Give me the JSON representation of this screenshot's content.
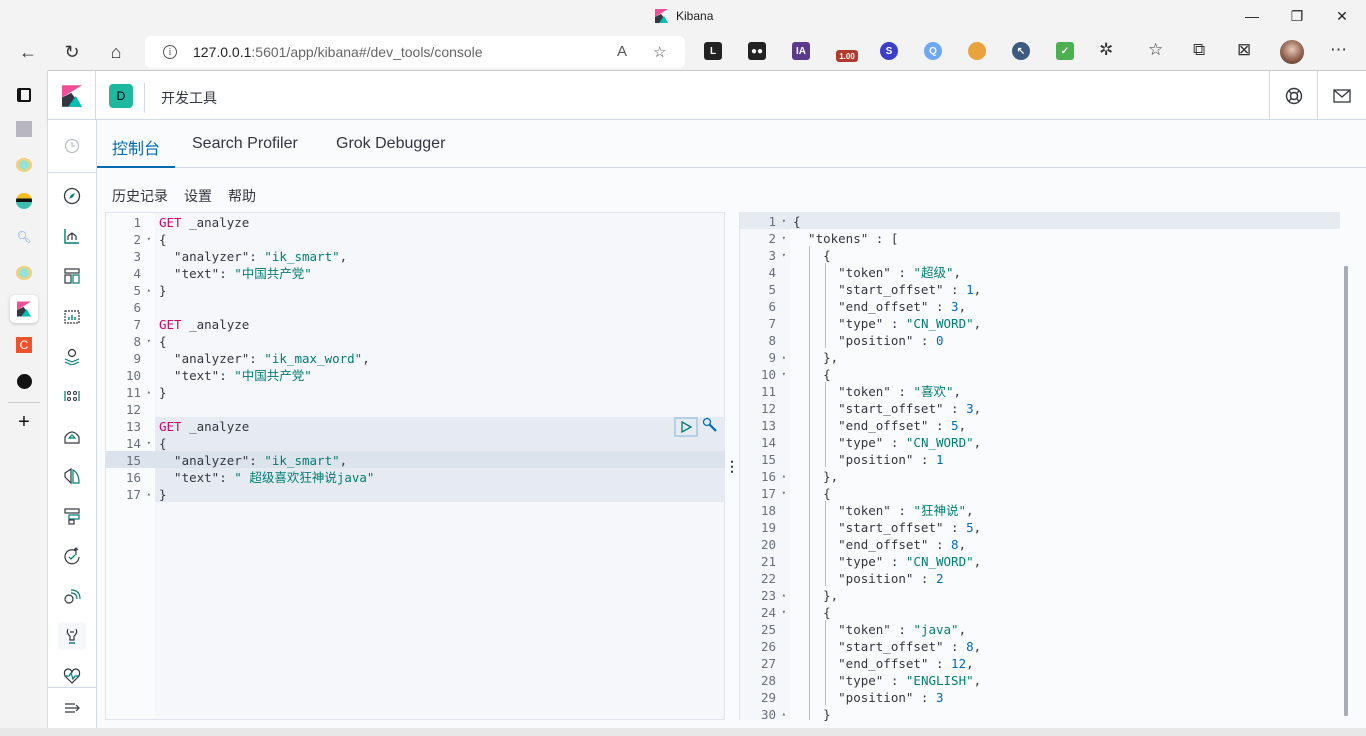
{
  "browser": {
    "tab_title": "Kibana",
    "url_host": "127.0.0.1",
    "url_rest": ":5601/app/kibana#/dev_tools/console",
    "extensions": [
      {
        "name": "leetcode-ext",
        "label": "L",
        "color": "#222222"
      },
      {
        "name": "tampermonkey-ext",
        "label": "●●",
        "color": "#222222"
      },
      {
        "name": "ia-ext",
        "label": "IA",
        "color": "#5b3a8c"
      },
      {
        "name": "video-speed-ext",
        "label": "1.00",
        "color": "#b03a2e"
      },
      {
        "name": "s-ext",
        "label": "S",
        "color": "#3b3fc7"
      },
      {
        "name": "search-ext",
        "label": "Q",
        "color": "#6fa8f7"
      },
      {
        "name": "fruit-ext",
        "label": "",
        "color": "#e8a33c"
      },
      {
        "name": "cursor-ext",
        "label": "↖",
        "color": "#3d5a80"
      },
      {
        "name": "adguard-ext",
        "label": "✓",
        "color": "#4caf50"
      }
    ]
  },
  "kibana": {
    "space_initial": "D",
    "breadcrumb": "开发工具",
    "tabs": [
      "控制台",
      "Search Profiler",
      "Grok Debugger"
    ],
    "active_tab": 0,
    "menu": [
      "历史记录",
      "设置",
      "帮助"
    ]
  },
  "colors": {
    "accent": "#006bb4",
    "space": "#1eb7a0",
    "keyword": "#c80a68",
    "string": "#017d73"
  },
  "editor": {
    "lines": [
      {
        "n": "1",
        "fold": "",
        "parts": [
          [
            "kw",
            "GET"
          ],
          [
            "key",
            " _analyze"
          ]
        ]
      },
      {
        "n": "2",
        "fold": "▾",
        "parts": [
          [
            "key",
            "{"
          ]
        ]
      },
      {
        "n": "3",
        "fold": "",
        "parts": [
          [
            "key",
            "  \"analyzer\": "
          ],
          [
            "str",
            "\"ik_smart\""
          ],
          [
            "key",
            ","
          ]
        ]
      },
      {
        "n": "4",
        "fold": "",
        "parts": [
          [
            "key",
            "  \"text\": "
          ],
          [
            "str",
            "\"中国共产党\""
          ]
        ]
      },
      {
        "n": "5",
        "fold": "▴",
        "parts": [
          [
            "key",
            "}"
          ]
        ]
      },
      {
        "n": "6",
        "fold": "",
        "parts": []
      },
      {
        "n": "7",
        "fold": "",
        "parts": [
          [
            "kw",
            "GET"
          ],
          [
            "key",
            " _analyze"
          ]
        ]
      },
      {
        "n": "8",
        "fold": "▾",
        "parts": [
          [
            "key",
            "{"
          ]
        ]
      },
      {
        "n": "9",
        "fold": "",
        "parts": [
          [
            "key",
            "  \"analyzer\": "
          ],
          [
            "str",
            "\"ik_max_word\""
          ],
          [
            "key",
            ","
          ]
        ]
      },
      {
        "n": "10",
        "fold": "",
        "parts": [
          [
            "key",
            "  \"text\": "
          ],
          [
            "str",
            "\"中国共产党\""
          ]
        ]
      },
      {
        "n": "11",
        "fold": "▴",
        "parts": [
          [
            "key",
            "}"
          ]
        ]
      },
      {
        "n": "12",
        "fold": "",
        "parts": []
      },
      {
        "n": "13",
        "fold": "",
        "parts": [
          [
            "kw",
            "GET"
          ],
          [
            "key",
            " _analyze"
          ]
        ]
      },
      {
        "n": "14",
        "fold": "▾",
        "parts": [
          [
            "key",
            "{"
          ]
        ]
      },
      {
        "n": "15",
        "fold": "",
        "parts": [
          [
            "key",
            "  \"analyzer\": "
          ],
          [
            "str",
            "\"ik_smart\""
          ],
          [
            "key",
            ","
          ]
        ]
      },
      {
        "n": "16",
        "fold": "",
        "parts": [
          [
            "key",
            "  \"text\": "
          ],
          [
            "str",
            "\" 超级喜欢狂神说java\""
          ]
        ]
      },
      {
        "n": "17",
        "fold": "▴",
        "parts": [
          [
            "key",
            "}"
          ]
        ]
      }
    ]
  },
  "output": {
    "lines": [
      {
        "n": "1",
        "fold": "▾",
        "parts": [
          [
            "key",
            "{"
          ]
        ]
      },
      {
        "n": "2",
        "fold": "▾",
        "parts": [
          [
            "key",
            "  \"tokens\" : ["
          ]
        ]
      },
      {
        "n": "3",
        "fold": "▾",
        "parts": [
          [
            "key",
            "    {"
          ]
        ]
      },
      {
        "n": "4",
        "fold": "",
        "parts": [
          [
            "key",
            "      \"token\" : "
          ],
          [
            "str",
            "\"超级\""
          ],
          [
            "key",
            ","
          ]
        ]
      },
      {
        "n": "5",
        "fold": "",
        "parts": [
          [
            "key",
            "      \"start_offset\" : "
          ],
          [
            "num",
            "1"
          ],
          [
            "key",
            ","
          ]
        ]
      },
      {
        "n": "6",
        "fold": "",
        "parts": [
          [
            "key",
            "      \"end_offset\" : "
          ],
          [
            "num",
            "3"
          ],
          [
            "key",
            ","
          ]
        ]
      },
      {
        "n": "7",
        "fold": "",
        "parts": [
          [
            "key",
            "      \"type\" : "
          ],
          [
            "str",
            "\"CN_WORD\""
          ],
          [
            "key",
            ","
          ]
        ]
      },
      {
        "n": "8",
        "fold": "",
        "parts": [
          [
            "key",
            "      \"position\" : "
          ],
          [
            "num",
            "0"
          ]
        ]
      },
      {
        "n": "9",
        "fold": "▴",
        "parts": [
          [
            "key",
            "    },"
          ]
        ]
      },
      {
        "n": "10",
        "fold": "▾",
        "parts": [
          [
            "key",
            "    {"
          ]
        ]
      },
      {
        "n": "11",
        "fold": "",
        "parts": [
          [
            "key",
            "      \"token\" : "
          ],
          [
            "str",
            "\"喜欢\""
          ],
          [
            "key",
            ","
          ]
        ]
      },
      {
        "n": "12",
        "fold": "",
        "parts": [
          [
            "key",
            "      \"start_offset\" : "
          ],
          [
            "num",
            "3"
          ],
          [
            "key",
            ","
          ]
        ]
      },
      {
        "n": "13",
        "fold": "",
        "parts": [
          [
            "key",
            "      \"end_offset\" : "
          ],
          [
            "num",
            "5"
          ],
          [
            "key",
            ","
          ]
        ]
      },
      {
        "n": "14",
        "fold": "",
        "parts": [
          [
            "key",
            "      \"type\" : "
          ],
          [
            "str",
            "\"CN_WORD\""
          ],
          [
            "key",
            ","
          ]
        ]
      },
      {
        "n": "15",
        "fold": "",
        "parts": [
          [
            "key",
            "      \"position\" : "
          ],
          [
            "num",
            "1"
          ]
        ]
      },
      {
        "n": "16",
        "fold": "▴",
        "parts": [
          [
            "key",
            "    },"
          ]
        ]
      },
      {
        "n": "17",
        "fold": "▾",
        "parts": [
          [
            "key",
            "    {"
          ]
        ]
      },
      {
        "n": "18",
        "fold": "",
        "parts": [
          [
            "key",
            "      \"token\" : "
          ],
          [
            "str",
            "\"狂神说\""
          ],
          [
            "key",
            ","
          ]
        ]
      },
      {
        "n": "19",
        "fold": "",
        "parts": [
          [
            "key",
            "      \"start_offset\" : "
          ],
          [
            "num",
            "5"
          ],
          [
            "key",
            ","
          ]
        ]
      },
      {
        "n": "20",
        "fold": "",
        "parts": [
          [
            "key",
            "      \"end_offset\" : "
          ],
          [
            "num",
            "8"
          ],
          [
            "key",
            ","
          ]
        ]
      },
      {
        "n": "21",
        "fold": "",
        "parts": [
          [
            "key",
            "      \"type\" : "
          ],
          [
            "str",
            "\"CN_WORD\""
          ],
          [
            "key",
            ","
          ]
        ]
      },
      {
        "n": "22",
        "fold": "",
        "parts": [
          [
            "key",
            "      \"position\" : "
          ],
          [
            "num",
            "2"
          ]
        ]
      },
      {
        "n": "23",
        "fold": "▴",
        "parts": [
          [
            "key",
            "    },"
          ]
        ]
      },
      {
        "n": "24",
        "fold": "▾",
        "parts": [
          [
            "key",
            "    {"
          ]
        ]
      },
      {
        "n": "25",
        "fold": "",
        "parts": [
          [
            "key",
            "      \"token\" : "
          ],
          [
            "str",
            "\"java\""
          ],
          [
            "key",
            ","
          ]
        ]
      },
      {
        "n": "26",
        "fold": "",
        "parts": [
          [
            "key",
            "      \"start_offset\" : "
          ],
          [
            "num",
            "8"
          ],
          [
            "key",
            ","
          ]
        ]
      },
      {
        "n": "27",
        "fold": "",
        "parts": [
          [
            "key",
            "      \"end_offset\" : "
          ],
          [
            "num",
            "12"
          ],
          [
            "key",
            ","
          ]
        ]
      },
      {
        "n": "28",
        "fold": "",
        "parts": [
          [
            "key",
            "      \"type\" : "
          ],
          [
            "str",
            "\"ENGLISH\""
          ],
          [
            "key",
            ","
          ]
        ]
      },
      {
        "n": "29",
        "fold": "",
        "parts": [
          [
            "key",
            "      \"position\" : "
          ],
          [
            "num",
            "3"
          ]
        ]
      },
      {
        "n": "30",
        "fold": "▴",
        "parts": [
          [
            "key",
            "    }"
          ]
        ]
      }
    ]
  }
}
